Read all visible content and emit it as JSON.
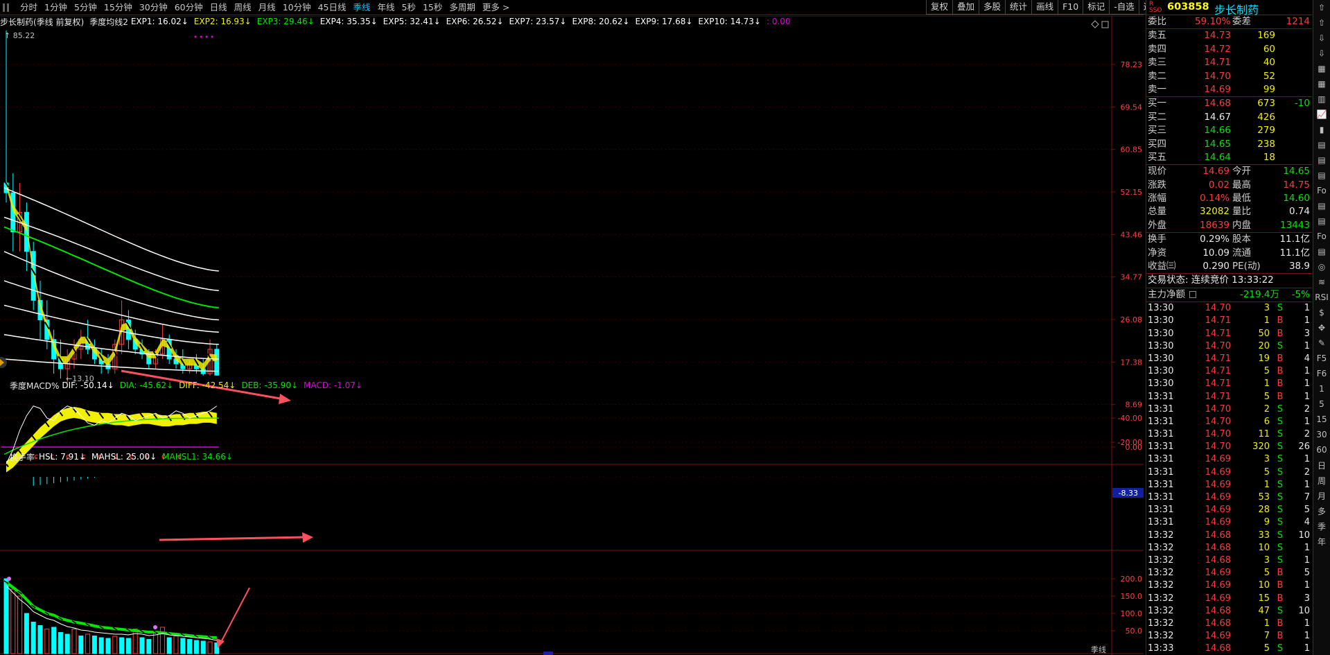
{
  "topbar": {
    "periods": [
      "分时",
      "1分钟",
      "5分钟",
      "15分钟",
      "30分钟",
      "60分钟",
      "日线",
      "周线",
      "月线",
      "10分钟",
      "45日线",
      "季线",
      "年线",
      "5秒",
      "15秒",
      "多周期",
      "更多 >"
    ],
    "active_index": 11,
    "tools": [
      "复权",
      "叠加",
      "多股",
      "统计",
      "画线",
      "F10",
      "标记",
      "-自选",
      "返回"
    ]
  },
  "main_chart": {
    "title": "步长制药(季线 前复权)",
    "indicator_name": "季度均线2",
    "series": [
      {
        "label": "EXP1: 16.02↓",
        "color": "#ffffff"
      },
      {
        "label": "EXP2: 16.93↓",
        "color": "#f0f000"
      },
      {
        "label": "EXP3: 29.46↓",
        "color": "#00e600"
      },
      {
        "label": "EXP4: 35.35↓",
        "color": "#ffffff"
      },
      {
        "label": "EXP5: 32.41↓",
        "color": "#ffffff"
      },
      {
        "label": "EXP6: 26.52↓",
        "color": "#ffffff"
      },
      {
        "label": "EXP7: 23.57↓",
        "color": "#ffffff"
      },
      {
        "label": "EXP8: 20.62↓",
        "color": "#ffffff"
      },
      {
        "label": "EXP9: 17.68↓",
        "color": "#ffffff"
      },
      {
        "label": "EXP10: 14.73↓",
        "color": "#ffffff"
      },
      {
        "label": ": 0.00",
        "color": "#e000e0"
      }
    ],
    "y_ticks": [
      "78.23",
      "69.54",
      "60.85",
      "52.15",
      "43.46",
      "34.77",
      "26.08",
      "17.38",
      "8.69",
      "0.00"
    ],
    "high_label": "85.22",
    "low_label": "13.10"
  },
  "macd_panel": {
    "name": "季度MACD%",
    "series": [
      {
        "label": "DIF: -50.14↓",
        "color": "#ffffff"
      },
      {
        "label": "DIA: -45.62↓",
        "color": "#00e600"
      },
      {
        "label": "DIFF: -42.54↓",
        "color": "#f0f000"
      },
      {
        "label": "DEB: -35.90↓",
        "color": "#00e600"
      },
      {
        "label": "MACD: -1.07↓",
        "color": "#e000e0"
      }
    ],
    "y_ticks": [
      "-20.00",
      "-40.00"
    ],
    "current_value": "-8.33"
  },
  "turnover_panel": {
    "name": "换手率",
    "series": [
      {
        "label": "HSL: 7.91↓",
        "color": "#ffffff"
      },
      {
        "label": "MAHSL: 25.00↓",
        "color": "#ffffff"
      },
      {
        "label": "MAHSL1: 34.66↓",
        "color": "#00e600"
      }
    ],
    "y_ticks": [
      "200.0",
      "150.0",
      "100.0",
      "50.0"
    ],
    "unit_label": "季线"
  },
  "quote": {
    "rz_label": "R\nSSO",
    "code": "603858",
    "name": "步长制药",
    "ratio": {
      "label1": "委比",
      "value1": "59.10%",
      "label2": "委差",
      "value2": "1214"
    },
    "asks": [
      {
        "label": "卖五",
        "price": "14.73",
        "vol": "169"
      },
      {
        "label": "卖四",
        "price": "14.72",
        "vol": "60"
      },
      {
        "label": "卖三",
        "price": "14.71",
        "vol": "40"
      },
      {
        "label": "卖二",
        "price": "14.70",
        "vol": "52"
      },
      {
        "label": "卖一",
        "price": "14.69",
        "vol": "99"
      }
    ],
    "bids": [
      {
        "label": "买一",
        "price": "14.68",
        "vol": "673",
        "chg": "-10"
      },
      {
        "label": "买二",
        "price": "14.67",
        "vol": "426",
        "chg": ""
      },
      {
        "label": "买三",
        "price": "14.66",
        "vol": "279",
        "chg": ""
      },
      {
        "label": "买四",
        "price": "14.65",
        "vol": "238",
        "chg": ""
      },
      {
        "label": "买五",
        "price": "14.64",
        "vol": "18",
        "chg": ""
      }
    ],
    "stats": [
      {
        "l1": "现价",
        "v1": "14.69",
        "l2": "今开",
        "v2": "14.65"
      },
      {
        "l1": "涨跌",
        "v1": "0.02",
        "l2": "最高",
        "v2": "14.75"
      },
      {
        "l1": "涨幅",
        "v1": "0.14%",
        "l2": "最低",
        "v2": "14.60"
      },
      {
        "l1": "总量",
        "v1": "32082",
        "l2": "量比",
        "v2": "0.74"
      },
      {
        "l1": "外盘",
        "v1": "18639",
        "l2": "内盘",
        "v2": "13443"
      }
    ],
    "stats2": [
      {
        "l1": "换手",
        "v1": "0.29%",
        "l2": "股本",
        "v2": "11.1亿"
      },
      {
        "l1": "净资",
        "v1": "10.09",
        "l2": "流通",
        "v2": "11.1亿"
      },
      {
        "l1": "收益㈢",
        "v1": "0.290",
        "l2": "PE(动)",
        "v2": "38.9"
      }
    ],
    "trade_status": "交易状态: 连续竞价 13:33:22",
    "main_flow": {
      "label": "主力净额",
      "value": "-219.4万",
      "pct": "-5%"
    }
  },
  "ticks": [
    [
      "13:30",
      "14.70",
      "3",
      "S",
      "1"
    ],
    [
      "13:30",
      "14.71",
      "1",
      "B",
      "1"
    ],
    [
      "13:30",
      "14.71",
      "50",
      "B",
      "3"
    ],
    [
      "13:30",
      "14.70",
      "20",
      "S",
      "1"
    ],
    [
      "13:30",
      "14.71",
      "19",
      "B",
      "4"
    ],
    [
      "13:30",
      "14.71",
      "5",
      "B",
      "1"
    ],
    [
      "13:30",
      "14.71",
      "1",
      "B",
      "1"
    ],
    [
      "13:31",
      "14.71",
      "5",
      "B",
      "1"
    ],
    [
      "13:31",
      "14.70",
      "2",
      "S",
      "2"
    ],
    [
      "13:31",
      "14.70",
      "6",
      "S",
      "1"
    ],
    [
      "13:31",
      "14.70",
      "11",
      "S",
      "2"
    ],
    [
      "13:31",
      "14.70",
      "320",
      "S",
      "26"
    ],
    [
      "13:31",
      "14.69",
      "3",
      "S",
      "1"
    ],
    [
      "13:31",
      "14.69",
      "5",
      "S",
      "2"
    ],
    [
      "13:31",
      "14.69",
      "1",
      "S",
      "1"
    ],
    [
      "13:31",
      "14.69",
      "53",
      "S",
      "7"
    ],
    [
      "13:31",
      "14.69",
      "28",
      "S",
      "5"
    ],
    [
      "13:31",
      "14.69",
      "9",
      "S",
      "4"
    ],
    [
      "13:32",
      "14.68",
      "33",
      "S",
      "10"
    ],
    [
      "13:32",
      "14.68",
      "10",
      "S",
      "1"
    ],
    [
      "13:32",
      "14.68",
      "3",
      "S",
      "1"
    ],
    [
      "13:32",
      "14.69",
      "5",
      "B",
      "5"
    ],
    [
      "13:32",
      "14.69",
      "10",
      "B",
      "1"
    ],
    [
      "13:32",
      "14.69",
      "15",
      "B",
      "3"
    ],
    [
      "13:32",
      "14.68",
      "47",
      "S",
      "10"
    ],
    [
      "13:32",
      "14.68",
      "1",
      "B",
      "1"
    ],
    [
      "13:32",
      "14.69",
      "7",
      "B",
      "1"
    ],
    [
      "13:33",
      "14.68",
      "5",
      "S",
      "1"
    ]
  ],
  "right_toolbar": [
    "⇧",
    "⇧",
    "⇩",
    "⇩",
    "▦",
    "▦",
    "▥",
    "📈",
    "▮",
    "▤",
    "▤",
    "▤",
    "Fo",
    "▤",
    "▤",
    "Fo",
    "▤",
    "◎",
    "≋",
    "RSI",
    "$",
    "✥",
    "✎",
    "F5",
    "F6",
    "1",
    "5",
    "15",
    "30",
    "60",
    "日",
    "周",
    "月",
    "多",
    "季",
    "年"
  ],
  "colors": {
    "up": "#ff3a3a",
    "down": "#00e600",
    "yellow": "#f0f000",
    "cyan": "#00e0ff",
    "frame": "#7a1010"
  }
}
